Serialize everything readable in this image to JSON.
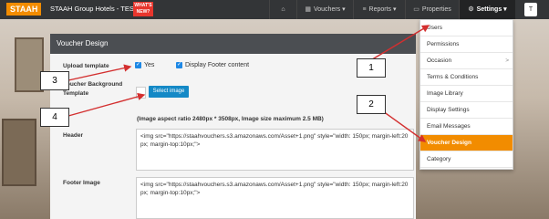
{
  "brand": "STAAH",
  "group_name": "STAAH Group Hotels - TEST",
  "whats_new": "WHAT'S NEW?",
  "nav": {
    "vouchers": "Vouchers",
    "reports": "Reports",
    "properties": "Properties",
    "settings": "Settings",
    "user_initial": "T"
  },
  "panel": {
    "title": "Voucher Design",
    "upload_label": "Upload template",
    "yes_label": "Yes",
    "display_footer_label": "Display Footer content",
    "bg_label": "Voucher Background Template",
    "select_image": "Select image",
    "hint": "(Image aspect ratio 2480px * 3508px, Image size maximum 2.5 MB)",
    "header_label": "Header",
    "header_value": "<img src=\"https://staahvouchers.s3.amazonaws.com/Asset+1.png\" style=\"width: 150px; margin-left:20px; margin-top:10px;\">",
    "footer_label": "Footer Image",
    "footer_value": "<img src=\"https://staahvouchers.s3.amazonaws.com/Asset+1.png\" style=\"width: 150px; margin-left:20px; margin-top:10px;\">"
  },
  "dropdown": {
    "items": [
      "Users",
      "Permissions",
      "Occasion",
      "Terms & Conditions",
      "Image Library",
      "Display Settings",
      "Email Messages",
      "Voucher Design",
      "Category"
    ],
    "active_index": 7,
    "submenu_caret": ">"
  },
  "callouts": {
    "c1": "1",
    "c2": "2",
    "c3": "3",
    "c4": "4"
  },
  "colors": {
    "brand_orange": "#f28c00",
    "accent_blue": "#1489c6",
    "arrow_red": "#d32f2f",
    "navbar": "#333537"
  },
  "icons": {
    "home": "home-icon",
    "vouchers": "ticket-icon",
    "reports": "list-icon",
    "properties": "document-icon",
    "settings": "gear-icon"
  }
}
